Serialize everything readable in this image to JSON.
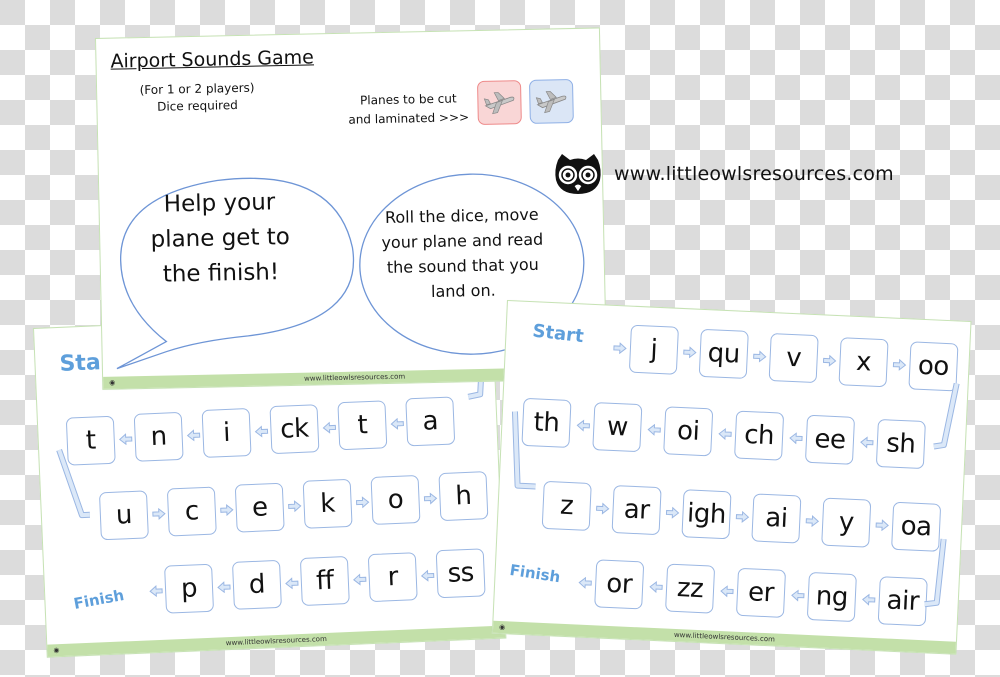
{
  "top_card": {
    "title": "Airport Sounds Game",
    "subtitle_line1": "(For 1 or 2 players)",
    "subtitle_line2": "Dice required",
    "planes_note_line1": "Planes  to be cut",
    "planes_note_line2": "and laminated >>>",
    "plane_tokens": [
      {
        "color": "red",
        "icon": "airplane-icon",
        "fill": "#f9d6d6",
        "border": "#ee8a8a"
      },
      {
        "color": "blue",
        "icon": "airplane-icon",
        "fill": "#dbe6f6",
        "border": "#8fb0e6"
      }
    ],
    "bubble_left_lines": [
      "Help your",
      "plane get to",
      "the finish!"
    ],
    "bubble_right_lines": [
      "Roll the dice, move",
      "your plane and read",
      "the sound that you",
      "land on."
    ],
    "footer_url": "www.littleowlsresources.com"
  },
  "site_logo": {
    "icon": "owl-icon",
    "url": "www.littleowlsresources.com"
  },
  "left_card": {
    "start_label": "Sta",
    "finish_label": "Finish",
    "row1": [
      "t",
      "n",
      "i",
      "ck",
      "t",
      "a"
    ],
    "row2": [
      "u",
      "c",
      "e",
      "k",
      "o",
      "h"
    ],
    "row3": [
      "p",
      "d",
      "ff",
      "r",
      "ss"
    ],
    "footer_url": "www.littleowlsresources.com"
  },
  "right_card": {
    "start_label": "Start",
    "finish_label": "Finish",
    "row1": [
      "j",
      "qu",
      "v",
      "x",
      "oo"
    ],
    "row2": [
      "th",
      "w",
      "oi",
      "ch",
      "ee",
      "sh"
    ],
    "row3": [
      "z",
      "ar",
      "igh",
      "ai",
      "y",
      "oa"
    ],
    "row4": [
      "or",
      "zz",
      "er",
      "ng",
      "air"
    ],
    "footer_url": "www.littleowlsresources.com"
  },
  "colors": {
    "tile_border": "#9bb7e3",
    "arrow_fill": "#dbe8f8",
    "label_blue": "#5e9fdb",
    "footer_green": "#c3e0a9",
    "card_border": "#c6e2b4"
  }
}
